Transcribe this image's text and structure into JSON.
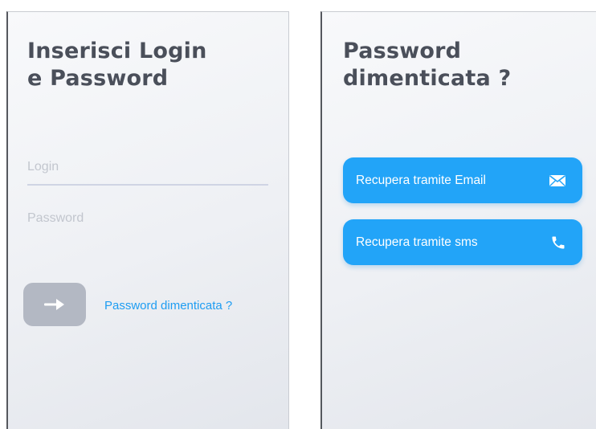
{
  "login_screen": {
    "title_line1": "Inserisci Login",
    "title_line2": "e Password",
    "login_placeholder": "Login",
    "password_placeholder": "Password",
    "forgot_link": "Password dimenticata ?",
    "submit_icon": "arrow-right-icon"
  },
  "recovery_screen": {
    "title_line1": "Password",
    "title_line2": "dimenticata ?",
    "email_button": "Recupera tramite Email",
    "email_icon": "envelope-icon",
    "sms_button": "Recupera tramite sms",
    "sms_icon": "phone-icon"
  },
  "colors": {
    "accent": "#22a4f8",
    "link": "#1e9df2",
    "title": "#4a4f5a",
    "submit_button": "#b3b8c3"
  }
}
